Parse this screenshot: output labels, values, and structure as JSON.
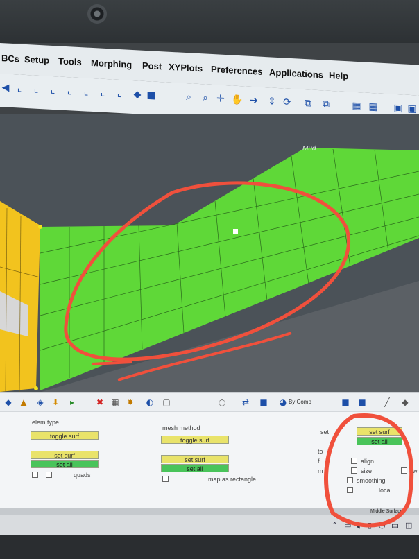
{
  "menu": {
    "items": [
      "BCs",
      "Setup",
      "Tools",
      "Morphing",
      "Post",
      "XYPlots",
      "Preferences",
      "Applications",
      "Help"
    ]
  },
  "viewport": {
    "model_label": "Mud"
  },
  "panel_toolbar": {
    "display_mode": "By Comp"
  },
  "panel": {
    "elem_type_label": "elem type",
    "toggle_surf_1": "toggle surf",
    "set_surf_1": "set surf",
    "set_all_1": "set all",
    "quads_label": "quads",
    "mesh_method_label": "mesh method",
    "toggle_surf_2": "toggle surf",
    "set_surf_2": "set surf",
    "set_all_2": "set all",
    "map_as_rectangle": "map as rectangle",
    "set_label": "set",
    "set_surf_3": "set surf",
    "set_all_3": "set all",
    "to_label": "to",
    "fl_label": "fl",
    "m_label": "m",
    "align_label": "align",
    "size_label": "size",
    "ew_label": "ew",
    "smoothing_label": "smoothing",
    "local_label": "local"
  },
  "taskbar": {
    "status_text": "Middle Surface",
    "lang": "中"
  },
  "colors": {
    "mesh_green": "#5fd838",
    "mesh_yellow": "#f2c31e",
    "annotation_red": "#f0503c"
  }
}
